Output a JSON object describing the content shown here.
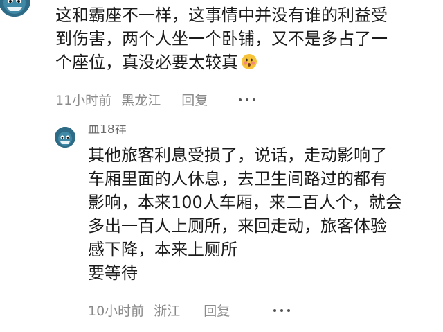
{
  "comment1": {
    "content_lines": [
      "这和霸座不一样，这事情中并没有谁的利益受",
      "到伤害，两个人坐一个卧铺，又不是多占了一",
      "个座位，真没必要太较真"
    ],
    "emoji_icon": "blush-face-emoji",
    "time": "11小时前",
    "location": "黑龙江",
    "reply_label": "回复",
    "more_icon": "more-dots-icon"
  },
  "reply1": {
    "username": "血18祥",
    "content_lines": [
      "其他旅客利息受损了，说话，走动影响了",
      "车厢里面的人休息，去卫生间路过的都有",
      "影响，本来100人车厢，来二百人个，就会",
      "多出一百人上厕所，来回走动，旅客体验",
      "感下降，本来上厕所",
      "要等待"
    ],
    "time": "10小时前",
    "location": "浙江",
    "reply_label": "回复",
    "more_icon": "more-dots-icon"
  },
  "colors": {
    "text": "#1b1b1b",
    "meta": "#8a8a8a",
    "avatar": "#2e6b86"
  }
}
